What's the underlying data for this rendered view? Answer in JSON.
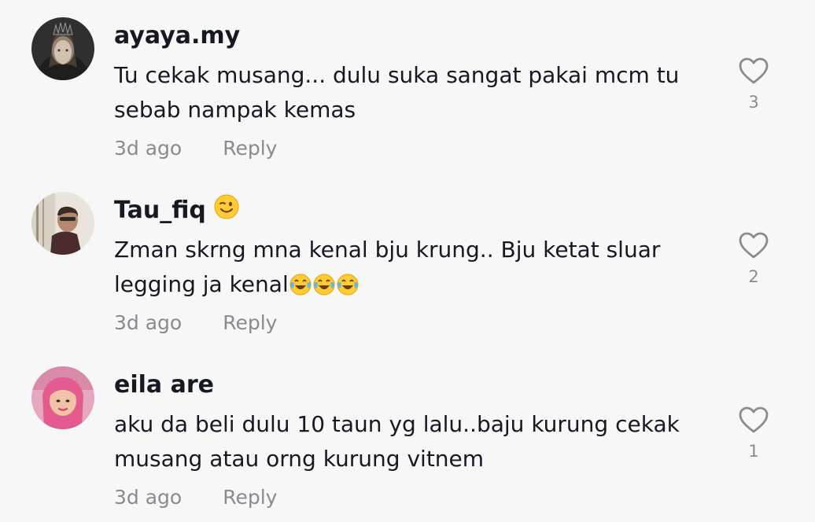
{
  "comments": [
    {
      "username": "ayaya.my",
      "text": "Tu cekak musang... dulu suka sangat pakai mcm tu sebab nampak kemas",
      "emoji_suffix": "",
      "time": "3d ago",
      "reply_label": "Reply",
      "likes": "3",
      "avatar_icon": "avatar-photo-crown-woman"
    },
    {
      "username": "Tau_fiq",
      "username_emoji": "winking-face",
      "text": "Zman skrng mna kenal bju krung.. Bju ketat sluar legging ja kenal",
      "emoji_suffix": "face-with-tears-of-joy x3",
      "time": "3d ago",
      "reply_label": "Reply",
      "likes": "2",
      "avatar_icon": "avatar-photo-man-dark"
    },
    {
      "username": "eila are",
      "text": "aku da beli dulu 10 taun yg lalu..baju kurung cekak musang atau orng kurung vitnem",
      "emoji_suffix": "",
      "time": "3d ago",
      "reply_label": "Reply",
      "likes": "1",
      "avatar_icon": "avatar-photo-woman-pink"
    }
  ],
  "colors": {
    "background": "#f7f7f7",
    "text_primary": "#161823",
    "text_secondary": "#8a8b91"
  }
}
